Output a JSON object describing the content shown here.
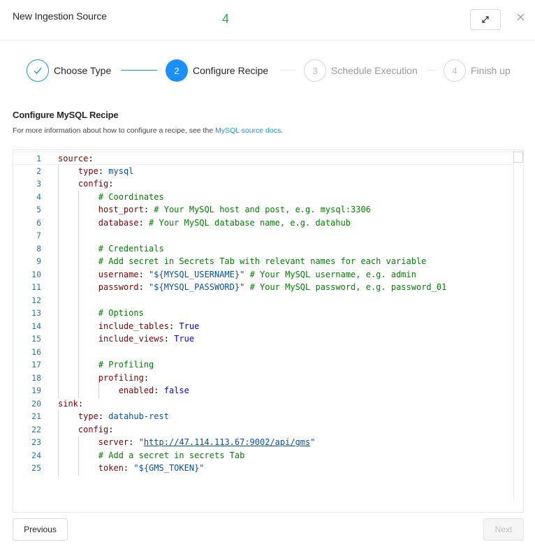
{
  "modal": {
    "title": "New Ingestion Source",
    "badge": "4",
    "expand_icon": "expand-icon",
    "close_icon": "close-icon",
    "close_glyph": "✕"
  },
  "steps": [
    {
      "number": "✓",
      "label": "Choose Type",
      "status": "finish"
    },
    {
      "number": "2",
      "label": "Configure Recipe",
      "status": "process"
    },
    {
      "number": "3",
      "label": "Schedule Execution",
      "status": "wait"
    },
    {
      "number": "4",
      "label": "Finish up",
      "status": "wait"
    }
  ],
  "section": {
    "title": "Configure MySQL Recipe",
    "description_prefix": "For more information about how to configure a recipe, see the ",
    "docs_link": "MySQL source docs."
  },
  "editor": {
    "line_numbers": [
      "1",
      "2",
      "3",
      "4",
      "5",
      "6",
      "7",
      "8",
      "9",
      "10",
      "11",
      "12",
      "13",
      "14",
      "15",
      "16",
      "17",
      "18",
      "19",
      "20",
      "21",
      "22",
      "23",
      "24",
      "25"
    ],
    "lines": [
      "source:",
      "    type: mysql",
      "    config:",
      "        # Coordinates",
      "        host_port: # Your MySQL host and post, e.g. mysql:3306",
      "        database: # Your MySQL database name, e.g. datahub",
      "",
      "        # Credentials",
      "        # Add secret in Secrets Tab with relevant names for each variable",
      "        username: \"${MYSQL_USERNAME}\" # Your MySQL username, e.g. admin",
      "        password: \"${MYSQL_PASSWORD}\" # Your MySQL password, e.g. password_01",
      "",
      "        # Options",
      "        include_tables: True",
      "        include_views: True",
      "",
      "        # Profiling",
      "        profiling:",
      "            enabled: false",
      "sink:",
      "    type: datahub-rest",
      "    config:",
      "        server: \"http://47.114.113.67:9002/api/gms\"",
      "        # Add a secret in secrets Tab",
      "        token: \"${GMS_TOKEN}\""
    ]
  },
  "footer": {
    "previous_label": "Previous",
    "next_label": "Next"
  },
  "colors": {
    "accent": "#1890ff",
    "badge": "#2fb344",
    "yaml_key": "#800000",
    "yaml_string": "#0451a5",
    "yaml_comment": "#008000",
    "yaml_keyword": "#0000ff",
    "line_number": "#237893"
  }
}
